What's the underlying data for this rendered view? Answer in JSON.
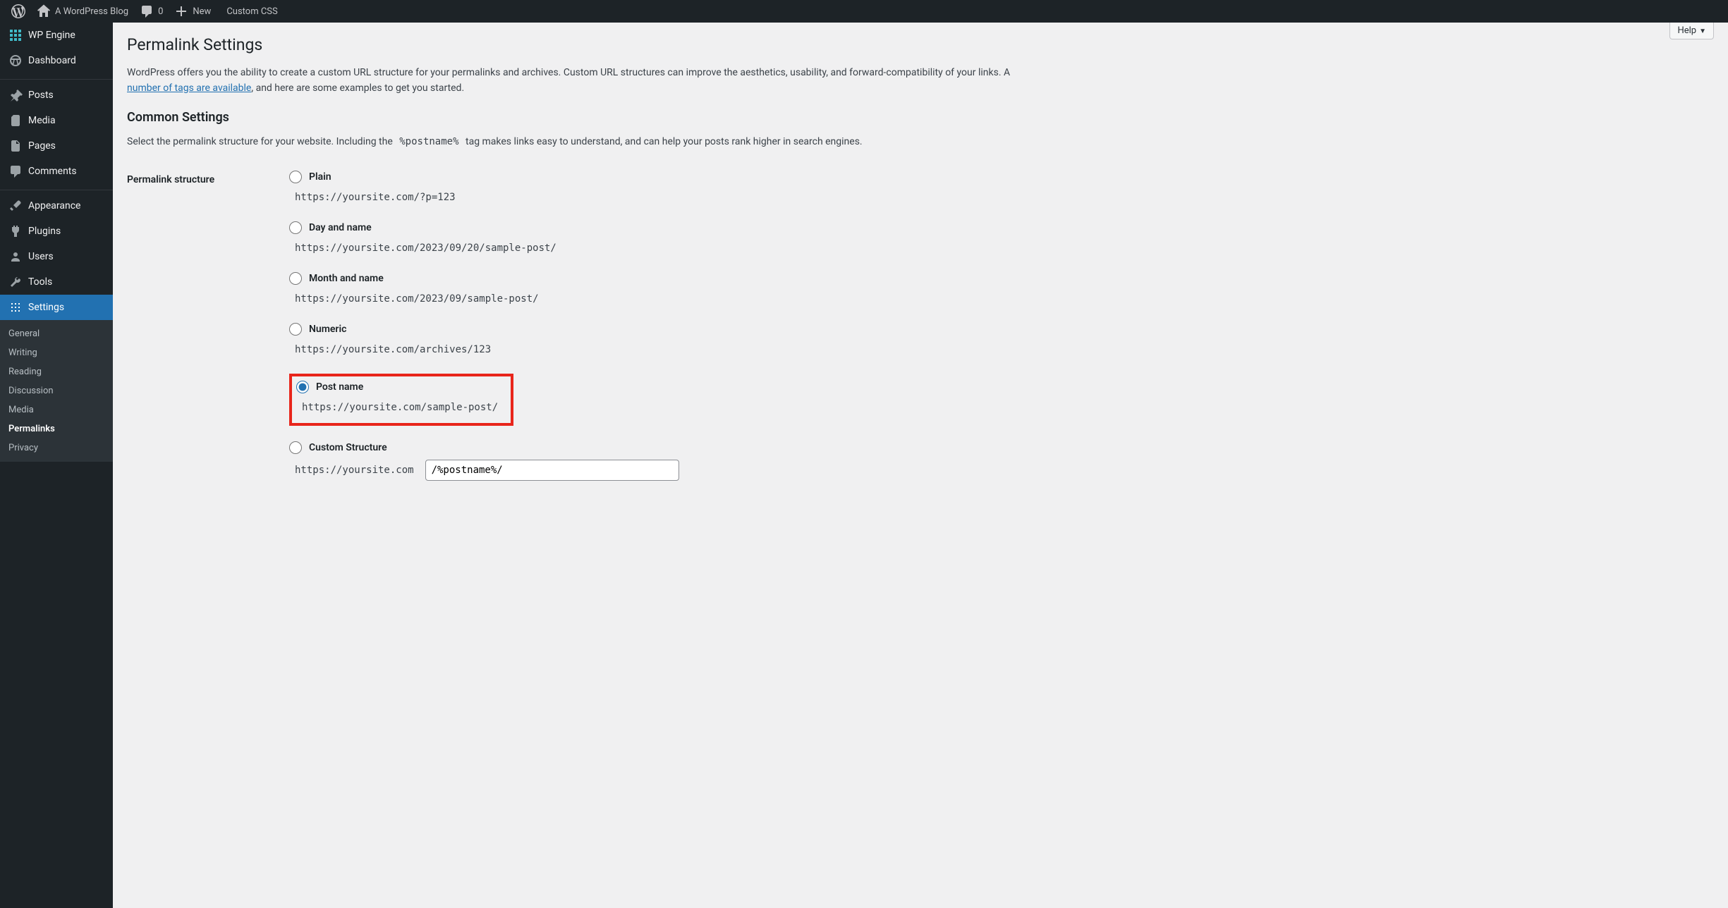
{
  "adminbar": {
    "site_name": "A WordPress Blog",
    "comments_count": "0",
    "new_label": "New",
    "custom_css_label": "Custom CSS"
  },
  "sidebar": {
    "items": [
      {
        "label": "WP Engine"
      },
      {
        "label": "Dashboard"
      },
      {
        "label": "Posts"
      },
      {
        "label": "Media"
      },
      {
        "label": "Pages"
      },
      {
        "label": "Comments"
      },
      {
        "label": "Appearance"
      },
      {
        "label": "Plugins"
      },
      {
        "label": "Users"
      },
      {
        "label": "Tools"
      },
      {
        "label": "Settings"
      }
    ],
    "submenu": [
      {
        "label": "General"
      },
      {
        "label": "Writing"
      },
      {
        "label": "Reading"
      },
      {
        "label": "Discussion"
      },
      {
        "label": "Media"
      },
      {
        "label": "Permalinks"
      },
      {
        "label": "Privacy"
      }
    ]
  },
  "help_label": "Help",
  "page": {
    "title": "Permalink Settings",
    "intro_a": "WordPress offers you the ability to create a custom URL structure for your permalinks and archives. Custom URL structures can improve the aesthetics, usability, and forward-compatibility of your links. A ",
    "intro_link": "number of tags are available",
    "intro_b": ", and here are some examples to get you started.",
    "common_heading": "Common Settings",
    "common_text_a": "Select the permalink structure for your website. Including the ",
    "common_tag": "%postname%",
    "common_text_b": " tag makes links easy to understand, and can help your posts rank higher in search engines.",
    "structure_label": "Permalink structure"
  },
  "options": [
    {
      "label": "Plain",
      "example": "https://yoursite.com/?p=123",
      "checked": false
    },
    {
      "label": "Day and name",
      "example": "https://yoursite.com/2023/09/20/sample-post/",
      "checked": false
    },
    {
      "label": "Month and name",
      "example": "https://yoursite.com/2023/09/sample-post/",
      "checked": false
    },
    {
      "label": "Numeric",
      "example": "https://yoursite.com/archives/123",
      "checked": false
    },
    {
      "label": "Post name",
      "example": "https://yoursite.com/sample-post/",
      "checked": true,
      "highlight": true
    },
    {
      "label": "Custom Structure",
      "prefix": "https://yoursite.com",
      "value": "/%postname%/",
      "checked": false
    }
  ]
}
